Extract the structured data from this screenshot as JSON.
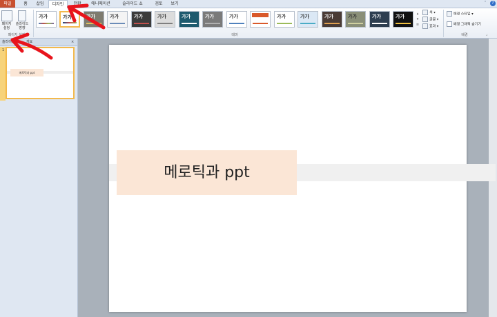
{
  "tabs": [
    "파일",
    "홈",
    "삽입",
    "디자인",
    "전환",
    "애니메이션",
    "슬라이드 쇼",
    "검토",
    "보기"
  ],
  "active_tab": "디자인",
  "ribbon": {
    "page_setup_label": "페이지 설정",
    "slide_orientation_label": "슬라이드 방향",
    "group_page_setup": "페이지 설정",
    "group_themes": "테마",
    "group_background": "배경",
    "theme_sample_text": "가가",
    "colors_label": "색",
    "fonts_label": "글꼴",
    "effects_label": "효과",
    "bg_styles_label": "배경 스타일",
    "hide_bg_graphics_label": "배경 그래픽 숨기기"
  },
  "left_pane": {
    "tab_slides": "슬라이드",
    "tab_outline": "개요",
    "thumb_number": "1",
    "thumb_text": "메로틱과 ppt"
  },
  "slide": {
    "title": "메로틱과 ppt"
  },
  "colors": {
    "file_tab": "#c8502f",
    "title_box": "#fbe6d6",
    "selection_border": "#f3b94c",
    "annotation": "#e8141c"
  }
}
